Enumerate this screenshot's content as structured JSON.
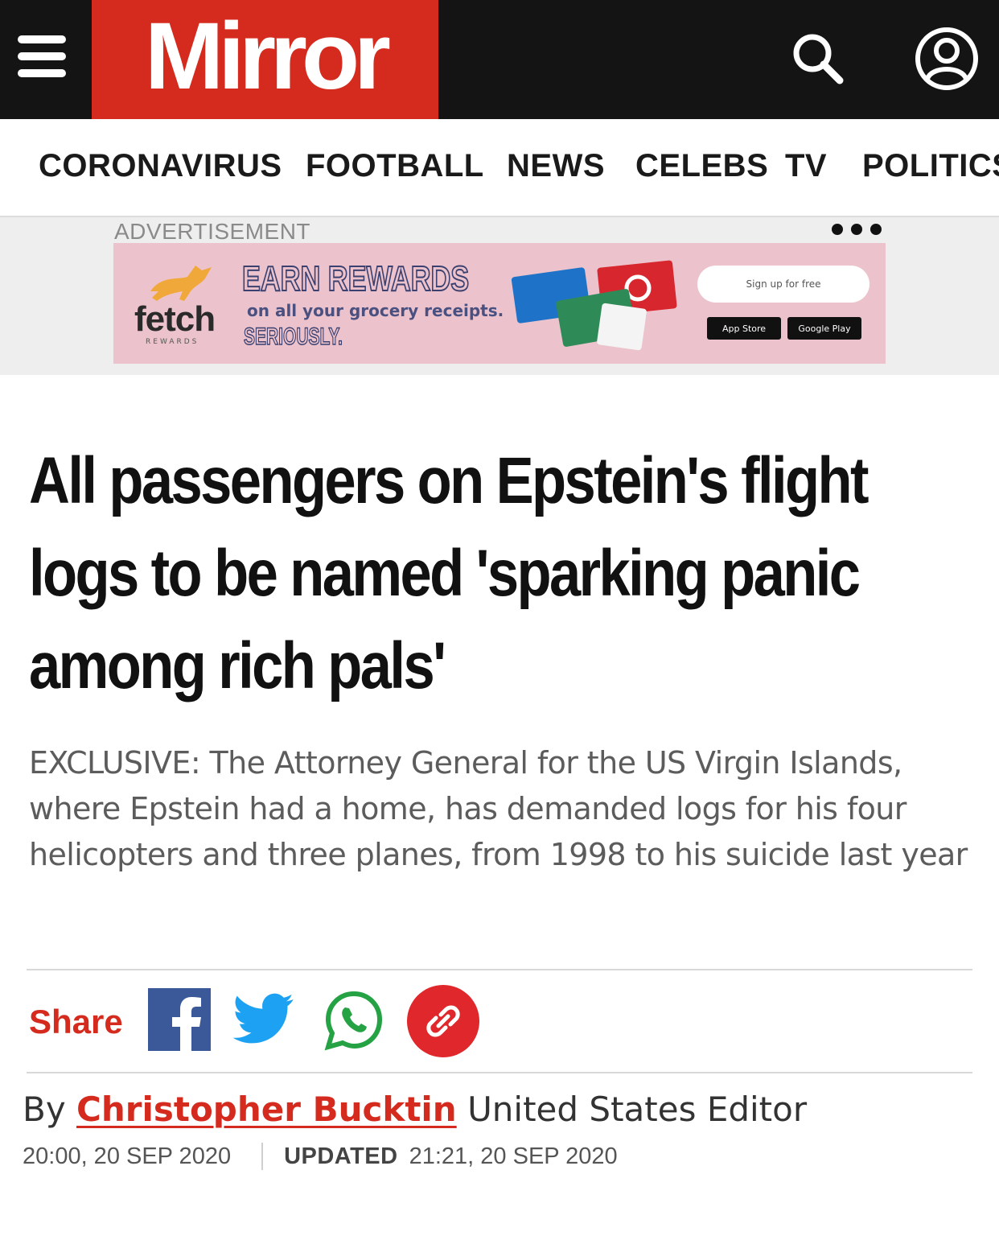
{
  "header": {
    "logo_text": "Mirror",
    "brand_color": "#d52b1e",
    "menu_icon": "hamburger-menu-icon",
    "search_icon": "search-icon",
    "account_icon": "account-icon"
  },
  "nav": {
    "items": [
      "CORONAVIRUS",
      "FOOTBALL",
      "NEWS",
      "CELEBS",
      "TV",
      "POLITICS"
    ]
  },
  "ad": {
    "label": "ADVERTISEMENT",
    "brand": "fetch",
    "brand_sub": "REWARDS",
    "headline": "EARN REWARDS",
    "subline": "on all your grocery receipts.",
    "tagline": "SERIOUSLY.",
    "cta": "Sign up for free",
    "app_store": "App Store",
    "google_play": "Google Play"
  },
  "article": {
    "headline": "All passengers on Epstein's flight logs to be named 'sparking panic among rich pals'",
    "standfirst": "EXCLUSIVE: The Attorney General for the US Virgin Islands, where Epstein had a home, has demanded logs for his four helicopters and three planes, from 1998 to his suicide last year"
  },
  "share": {
    "label": "Share",
    "icons": [
      "facebook-icon",
      "twitter-icon",
      "whatsapp-icon",
      "copy-link-icon"
    ]
  },
  "byline": {
    "prefix": "By",
    "author": "Christopher Bucktin",
    "role": "United States Editor",
    "published": "20:00, 20 SEP 2020",
    "updated_label": "UPDATED",
    "updated": "21:21, 20 SEP 2020"
  }
}
